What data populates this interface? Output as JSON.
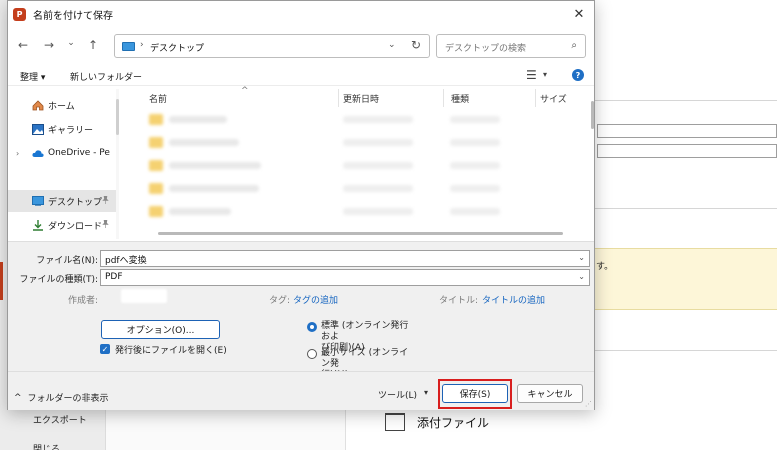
{
  "background": {
    "export_label": "エクスポート",
    "close_label": "閉じる",
    "attach_label": "添付ファイル",
    "yellow_text": "す。"
  },
  "dialog": {
    "title": "名前を付けて保存",
    "app_icon": "P",
    "close_glyph": "✕"
  },
  "address_bar": {
    "back": "←",
    "forward": "→",
    "recent": "⌄",
    "up": "↑",
    "sep": "›",
    "path": "デスクトップ",
    "dropdown": "⌄",
    "refresh": "↻",
    "search_placeholder": "デスクトップの検索",
    "search_glyph": "⌕"
  },
  "toolbar": {
    "organize": "整理 ▾",
    "new_folder": "新しいフォルダー",
    "view_glyph": "☰",
    "view_drop": "▾",
    "help_glyph": "?"
  },
  "nav": {
    "items": [
      {
        "label": "ホーム",
        "icon": "home-icon"
      },
      {
        "label": "ギャラリー",
        "icon": "gallery-icon"
      },
      {
        "label": "OneDrive - Perso",
        "icon": "cloud-icon",
        "chevron": "›"
      },
      {
        "label": "デスクトップ",
        "icon": "desktop-folder-icon",
        "pin": "📌"
      },
      {
        "label": "ダウンロード",
        "icon": "download-icon",
        "pin": "📌"
      }
    ]
  },
  "filelist": {
    "columns": [
      "名前",
      "更新日時",
      "種類",
      "サイズ"
    ],
    "sort_glyph": "^"
  },
  "form": {
    "filename_label": "ファイル名(N):",
    "filename_value": "pdfへ変換",
    "filetype_label": "ファイルの種類(T):",
    "filetype_value": "PDF",
    "dropdown_glyph": "⌄",
    "author_label": "作成者:",
    "tags_label": "タグ:",
    "tags_link": "タグの追加",
    "title_label": "タイトル:",
    "title_link": "タイトルの追加",
    "options_button": "オプション(O)...",
    "open_after_label": "発行後にファイルを開く(E)",
    "check_glyph": "✓",
    "radio_standard": "標準 (オンライン発行およ\nび印刷)(A)",
    "radio_min": "最小サイズ (オンライン発\n行)(M)"
  },
  "footer": {
    "hide_folders": "フォルダーの非表示",
    "hide_glyph": "^",
    "tools": "ツール(L)",
    "tools_drop": "▾",
    "save": "保存(S)",
    "cancel": "キャンセル"
  }
}
